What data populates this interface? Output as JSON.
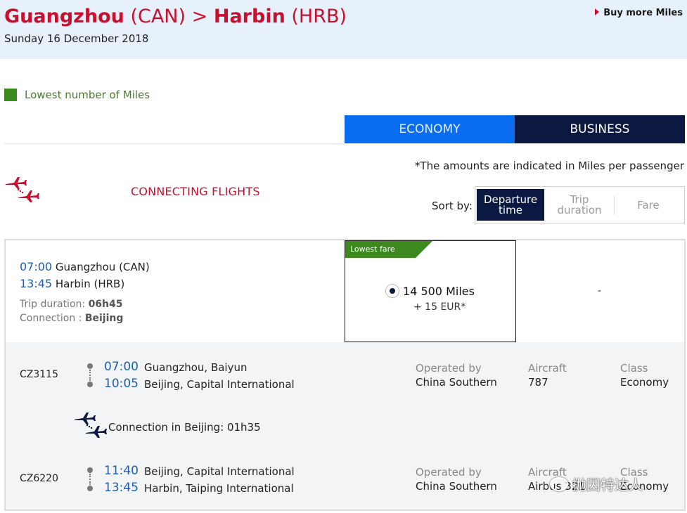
{
  "header": {
    "origin_city": "Guangzhou",
    "origin_code": "(CAN)",
    "separator": ">",
    "dest_city": "Harbin",
    "dest_code": "(HRB)",
    "date": "Sunday 16 December 2018",
    "buy_more": "Buy more Miles"
  },
  "legend": {
    "label": "Lowest number of Miles",
    "color": "#3c8a1f"
  },
  "tabs": [
    {
      "label": "ECONOMY",
      "active": true
    },
    {
      "label": "BUSINESS",
      "active": false
    }
  ],
  "note": "*The amounts are indicated in Miles per passenger",
  "section": {
    "label": "CONNECTING FLIGHTS",
    "icon": "connecting-flights-icon"
  },
  "sort": {
    "label": "Sort by:",
    "options": [
      {
        "line1": "Departure",
        "line2": "time",
        "active": true
      },
      {
        "line1": "Trip",
        "line2": "duration",
        "active": false
      },
      {
        "line1": "Fare",
        "line2": "",
        "active": false
      }
    ]
  },
  "itinerary": {
    "dep_time": "07:00",
    "dep_place": "Guangzhou (CAN)",
    "arr_time": "13:45",
    "arr_place": "Harbin (HRB)",
    "duration_label": "Trip duration:",
    "duration_value": "06h45",
    "connection_label": "Connection :",
    "connection_value": "Beijing",
    "fare": {
      "badge": "Lowest fare",
      "miles": "14 500 Miles",
      "eur": "+ 15 EUR*",
      "selected": true
    },
    "business_fare": "-",
    "segments": [
      {
        "flight": "CZ3115",
        "dep_time": "07:00",
        "dep_place": "Guangzhou, Baiyun",
        "arr_time": "10:05",
        "arr_place": "Beijing, Capital International",
        "operated_label": "Operated by",
        "operated_value": "China Southern",
        "aircraft_label": "Aircraft",
        "aircraft_value": "787",
        "class_label": "Class",
        "class_value": "Economy"
      },
      {
        "flight": "CZ6220",
        "dep_time": "11:40",
        "dep_place": "Beijing, Capital International",
        "arr_time": "13:45",
        "arr_place": "Harbin, Taiping International",
        "operated_label": "Operated by",
        "operated_value": "China Southern",
        "aircraft_label": "Aircraft",
        "aircraft_value": "Airbus 321",
        "class_label": "Class",
        "class_value": "Economy"
      }
    ],
    "connection_text": "Connection in Beijing: 01h35"
  },
  "watermark": "抛因特达人"
}
